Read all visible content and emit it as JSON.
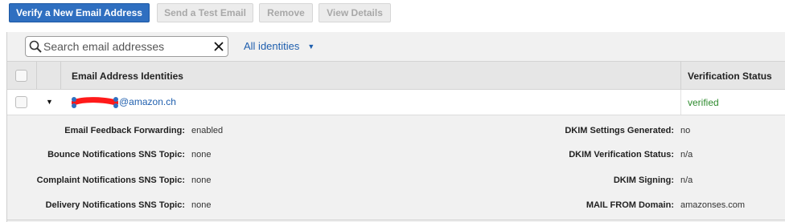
{
  "toolbar": {
    "verify_label": "Verify a New Email Address",
    "test_label": "Send a Test Email",
    "remove_label": "Remove",
    "details_label": "View Details"
  },
  "search": {
    "placeholder": "Search email addresses",
    "filter_label": "All identities"
  },
  "table": {
    "columns": [
      "Email Address Identities",
      "Verification Status"
    ],
    "rows": [
      {
        "email_domain": "@amazon.ch",
        "status": "verified"
      }
    ]
  },
  "details": {
    "left": [
      {
        "label": "Email Feedback Forwarding:",
        "value": "enabled"
      },
      {
        "label": "Bounce Notifications SNS Topic:",
        "value": "none"
      },
      {
        "label": "Complaint Notifications SNS Topic:",
        "value": "none"
      },
      {
        "label": "Delivery Notifications SNS Topic:",
        "value": "none"
      }
    ],
    "right": [
      {
        "label": "DKIM Settings Generated:",
        "value": "no"
      },
      {
        "label": "DKIM Verification Status:",
        "value": "n/a"
      },
      {
        "label": "DKIM Signing:",
        "value": "n/a"
      },
      {
        "label": "MAIL FROM Domain:",
        "value": "amazonses.com"
      }
    ]
  },
  "colors": {
    "primary": "#2f6fc0",
    "link": "#1f5fae",
    "verified": "#2e8b2e",
    "redaction": "#ff1a1a"
  }
}
